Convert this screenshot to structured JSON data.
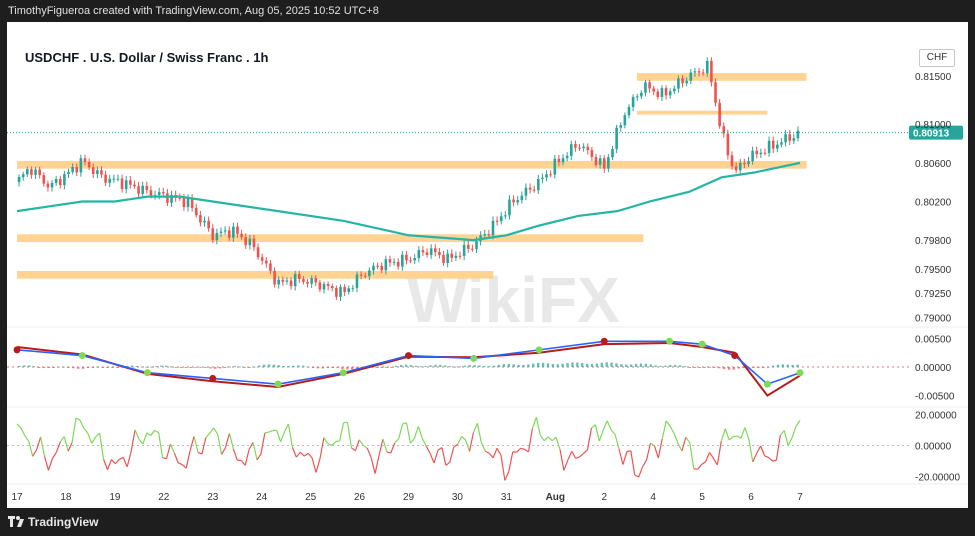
{
  "header": {
    "attribution": "TimothyFigueroa created with TradingView.com, Aug 05, 2025 10:52 UTC+8"
  },
  "footer": {
    "brand": "TradingView"
  },
  "chart_title": "USDCHF . U.S. Dollar / Swiss Franc . 1h",
  "currency_label": "CHF",
  "watermark": "WikiFX",
  "colors": {
    "candle_up": "#26a69a",
    "candle_down": "#ef5350",
    "ma_line": "#26b5a5",
    "zone": "#ffcc80",
    "macd_line": "#2962ff",
    "signal_line": "#b71c1c",
    "histogram_up": "#26a69a",
    "histogram_down": "#ef5350",
    "oscillator_up": "#7ed957",
    "oscillator_down": "#ef5350"
  },
  "chart_data": [
    {
      "type": "candlestick",
      "title": "USDCHF . U.S. Dollar / Swiss Franc . 1h",
      "x_ticks": [
        "17",
        "18",
        "19",
        "22",
        "23",
        "24",
        "25",
        "26",
        "29",
        "30",
        "31",
        "Aug",
        "2",
        "4",
        "5",
        "6",
        "7"
      ],
      "y_ticks": [
        "0.81500",
        "0.81000",
        "0.80600",
        "0.80200",
        "0.79800",
        "0.79500",
        "0.79250",
        "0.79000"
      ],
      "ylim": [
        0.789,
        0.818
      ],
      "last_price": "0.80913",
      "price_path": [
        [
          0,
          0.804
        ],
        [
          0.2,
          0.8055
        ],
        [
          0.5,
          0.8035
        ],
        [
          0.8,
          0.805
        ],
        [
          1.0,
          0.8062
        ],
        [
          1.3,
          0.8045
        ],
        [
          1.6,
          0.804
        ],
        [
          2.0,
          0.803
        ],
        [
          2.3,
          0.8025
        ],
        [
          2.6,
          0.802
        ],
        [
          3.0,
          0.7985
        ],
        [
          3.3,
          0.799
        ],
        [
          3.6,
          0.7975
        ],
        [
          4.0,
          0.7935
        ],
        [
          4.3,
          0.794
        ],
        [
          4.6,
          0.7935
        ],
        [
          5.0,
          0.7925
        ],
        [
          5.3,
          0.7945
        ],
        [
          5.6,
          0.7955
        ],
        [
          6.0,
          0.796
        ],
        [
          6.3,
          0.797
        ],
        [
          6.6,
          0.796
        ],
        [
          7.0,
          0.7975
        ],
        [
          7.3,
          0.7995
        ],
        [
          7.6,
          0.802
        ],
        [
          8.0,
          0.804
        ],
        [
          8.3,
          0.8062
        ],
        [
          8.6,
          0.808
        ],
        [
          9.0,
          0.8055
        ],
        [
          9.3,
          0.811
        ],
        [
          9.6,
          0.814
        ],
        [
          9.9,
          0.813
        ],
        [
          10.3,
          0.815
        ],
        [
          10.6,
          0.816
        ],
        [
          10.8,
          0.809
        ],
        [
          11.0,
          0.805
        ],
        [
          11.2,
          0.8065
        ],
        [
          11.5,
          0.8075
        ],
        [
          11.8,
          0.8085
        ],
        [
          12.0,
          0.8091
        ]
      ],
      "ma": [
        [
          0,
          0.801
        ],
        [
          0.5,
          0.8015
        ],
        [
          1.0,
          0.802
        ],
        [
          1.5,
          0.802
        ],
        [
          2.0,
          0.8025
        ],
        [
          2.5,
          0.8025
        ],
        [
          3.0,
          0.802
        ],
        [
          4.0,
          0.801
        ],
        [
          5.0,
          0.8
        ],
        [
          6.0,
          0.7985
        ],
        [
          7.0,
          0.798
        ],
        [
          7.5,
          0.7985
        ],
        [
          8.0,
          0.7995
        ],
        [
          8.6,
          0.8005
        ],
        [
          9.2,
          0.801
        ],
        [
          9.7,
          0.802
        ],
        [
          10.3,
          0.803
        ],
        [
          10.8,
          0.8045
        ],
        [
          11.3,
          0.805
        ],
        [
          12.0,
          0.806
        ]
      ],
      "zones": [
        {
          "start": 9.5,
          "end": 12.1,
          "level": 0.8149,
          "width": 0.0008
        },
        {
          "start": 9.5,
          "end": 11.5,
          "level": 0.8112,
          "width": 0.0004
        },
        {
          "start": 0,
          "end": 12.1,
          "level": 0.8058,
          "width": 0.0008
        },
        {
          "start": 0,
          "end": 9.6,
          "level": 0.7982,
          "width": 0.0008
        },
        {
          "start": 0,
          "end": 7.3,
          "level": 0.7944,
          "width": 0.0008
        }
      ]
    },
    {
      "type": "line",
      "name": "macd",
      "y_ticks": [
        "0.00500",
        "0.00000",
        "-0.00500"
      ],
      "ylim": [
        -0.007,
        0.007
      ],
      "macd": [
        [
          0,
          0.003
        ],
        [
          1.0,
          0.002
        ],
        [
          2.0,
          -0.001
        ],
        [
          3.0,
          -0.002
        ],
        [
          4.0,
          -0.003
        ],
        [
          5.0,
          -0.001
        ],
        [
          6.0,
          0.002
        ],
        [
          7.0,
          0.0015
        ],
        [
          8.0,
          0.003
        ],
        [
          9.0,
          0.0045
        ],
        [
          10.0,
          0.0045
        ],
        [
          10.5,
          0.004
        ],
        [
          11.0,
          0.002
        ],
        [
          11.5,
          -0.003
        ],
        [
          12.0,
          -0.001
        ]
      ],
      "signal": [
        [
          0,
          0.0035
        ],
        [
          1.0,
          0.0022
        ],
        [
          2.0,
          -0.0012
        ],
        [
          3.0,
          -0.0025
        ],
        [
          4.0,
          -0.0035
        ],
        [
          5.0,
          -0.0012
        ],
        [
          6.0,
          0.0018
        ],
        [
          7.0,
          0.0017
        ],
        [
          8.0,
          0.0025
        ],
        [
          9.0,
          0.004
        ],
        [
          10.0,
          0.0042
        ],
        [
          10.5,
          0.0035
        ],
        [
          11.0,
          0.0025
        ],
        [
          11.5,
          -0.005
        ],
        [
          12.0,
          -0.0015
        ]
      ],
      "histogram": [
        [
          0,
          0.0002
        ],
        [
          1,
          -0.0002
        ],
        [
          2,
          0.0002
        ],
        [
          3,
          -0.0002
        ],
        [
          4,
          0.0004
        ],
        [
          5,
          -0.0004
        ],
        [
          6,
          0.0003
        ],
        [
          7,
          0.0002
        ],
        [
          8,
          0.0006
        ],
        [
          9,
          0.0007
        ],
        [
          10,
          0.0003
        ],
        [
          11,
          -0.0004
        ],
        [
          12,
          0.0006
        ]
      ]
    },
    {
      "type": "line",
      "name": "oscillator",
      "y_ticks": [
        "20.00000",
        "0.00000",
        "-20.00000"
      ],
      "ylim": [
        -25,
        25
      ],
      "values": [
        [
          0,
          10
        ],
        [
          0.5,
          -10
        ],
        [
          1.0,
          15
        ],
        [
          1.5,
          -15
        ],
        [
          2.0,
          10
        ],
        [
          2.5,
          -12
        ],
        [
          3.0,
          8
        ],
        [
          3.5,
          -10
        ],
        [
          4.0,
          12
        ],
        [
          4.5,
          -12
        ],
        [
          5.0,
          10
        ],
        [
          5.5,
          -10
        ],
        [
          6.0,
          12
        ],
        [
          6.5,
          -10
        ],
        [
          7.0,
          8
        ],
        [
          7.5,
          -15
        ],
        [
          8.0,
          12
        ],
        [
          8.5,
          -12
        ],
        [
          9.0,
          15
        ],
        [
          9.5,
          -18
        ],
        [
          10.0,
          12
        ],
        [
          10.5,
          -15
        ],
        [
          11.0,
          10
        ],
        [
          11.5,
          -10
        ],
        [
          12.0,
          15
        ]
      ]
    }
  ]
}
